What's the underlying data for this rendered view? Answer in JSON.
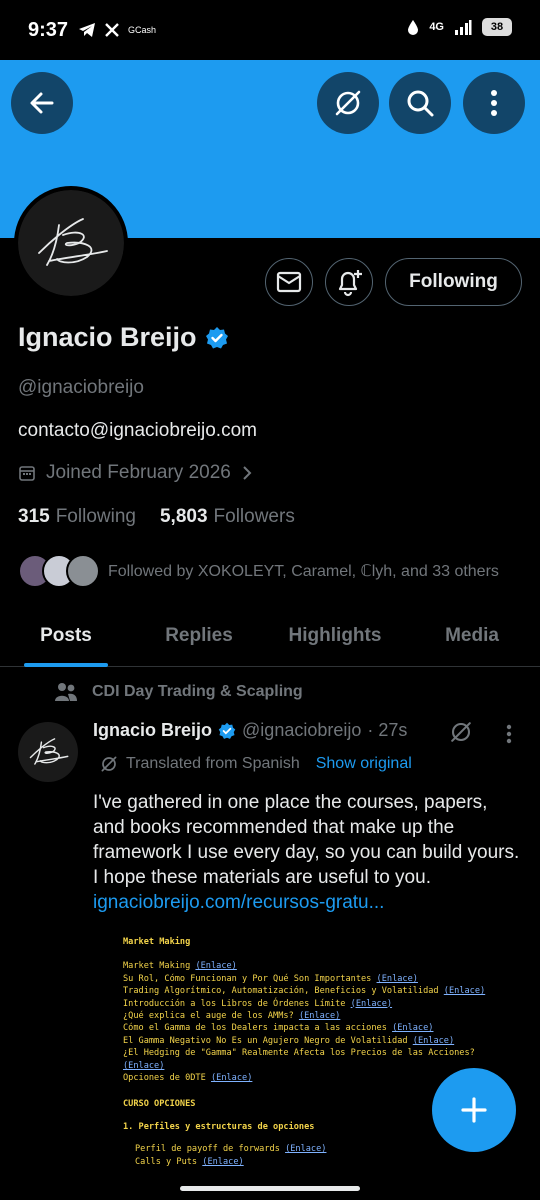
{
  "status": {
    "time": "9:37",
    "left_icons": [
      "telegram-icon",
      "x-icon",
      "gcash-icon"
    ],
    "gcash_label": "GCash",
    "network": "4G",
    "battery": "38"
  },
  "header": {
    "back_icon": "back-arrow-icon",
    "grok_icon": "grok-icon",
    "search_icon": "search-icon",
    "more_icon": "more-vertical-icon",
    "banner_color": "#1d9bf0"
  },
  "profile": {
    "name": "Ignacio Breijo",
    "handle": "@ignaciobreijo",
    "bio": "contacto@ignaciobreijo.com",
    "joined": "Joined February 2026",
    "following_count": "315",
    "following_label": "Following",
    "followers_count": "5,803",
    "followers_label": "Followers",
    "followed_by": "Followed by XOKOLEYT, Caramel, ℂlyh, and 33 others",
    "following_button": "Following"
  },
  "tabs": [
    {
      "label": "Posts",
      "active": true
    },
    {
      "label": "Replies",
      "active": false
    },
    {
      "label": "Highlights",
      "active": false
    },
    {
      "label": "Media",
      "active": false
    }
  ],
  "post": {
    "community": "CDI Day Trading & Scapling",
    "author": "Ignacio Breijo",
    "handle": "@ignaciobreijo",
    "time": "· 27s",
    "translated": "Translated from Spanish",
    "show_original": "Show original",
    "text": "I've gathered in one place the courses, papers, and books recommended that make up the framework I use every day, so you can build yours. I hope these materials are useful to you.",
    "link": "ignaciobreijo.com/recursos-gratu...",
    "document": {
      "title": "Market Making",
      "lines": [
        {
          "text": "Market Making",
          "link": "(Enlace)"
        },
        {
          "text": "Su Rol, Cómo Funcionan y Por Qué Son Importantes",
          "link": "(Enlace)"
        },
        {
          "text": "Trading Algorítmico, Automatización, Beneficios y Volatilidad",
          "link": "(Enlace)"
        },
        {
          "text": "Introducción a los Libros de Órdenes Límite",
          "link": "(Enlace)"
        },
        {
          "text": "¿Qué explica el auge de los AMMs?",
          "link": "(Enlace)"
        },
        {
          "text": "Cómo el Gamma de los Dealers impacta a las acciones",
          "link": "(Enlace)"
        },
        {
          "text": "El Gamma Negativo No Es un Agujero Negro de Volatilidad",
          "link": "(Enlace)"
        },
        {
          "text": "¿El Hedging de \"Gamma\" Realmente Afecta los Precios de las Acciones?",
          "link": ""
        },
        {
          "text": "",
          "link": "(Enlace)"
        },
        {
          "text": "Opciones de 0DTE",
          "link": "(Enlace)"
        }
      ],
      "section2": "CURSO OPCIONES",
      "subsection": "1. Perfiles y estructuras de opciones",
      "lines2": [
        {
          "text": "Perfil de payoff de forwards",
          "link": "(Enlace)"
        },
        {
          "text": "Calls y Puts",
          "link": "(Enlace)"
        }
      ]
    }
  },
  "fab_icon": "plus-icon",
  "accent": "#1d9bf0"
}
